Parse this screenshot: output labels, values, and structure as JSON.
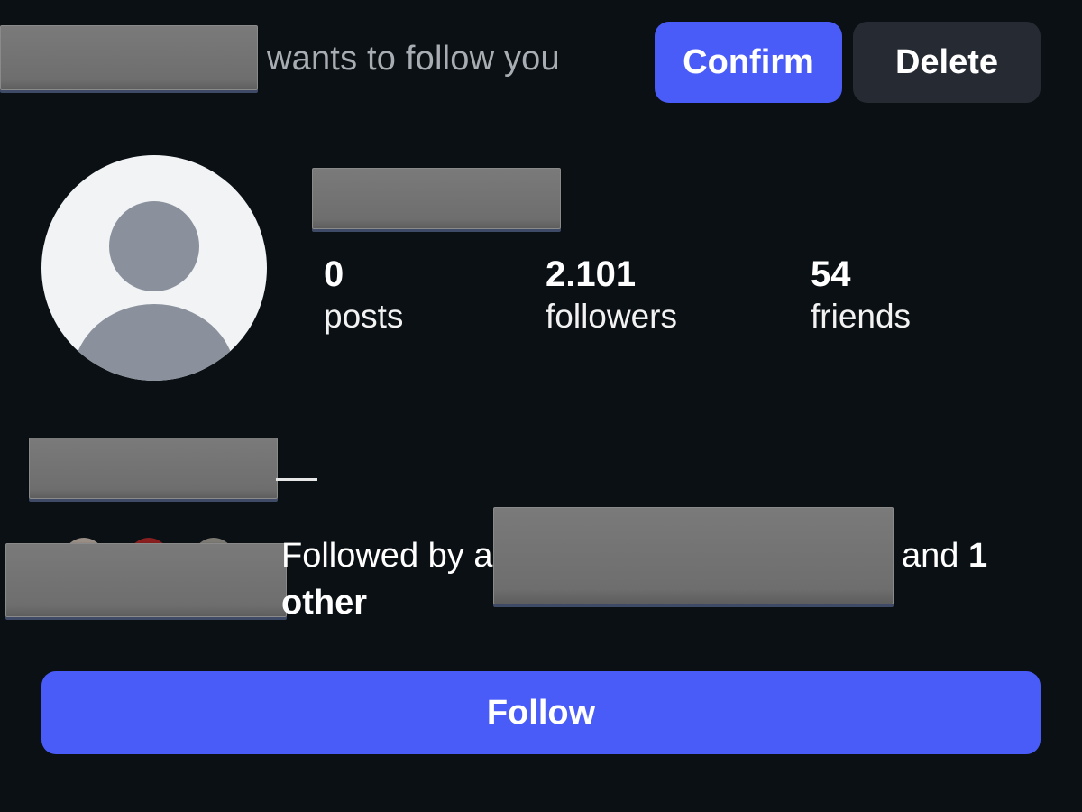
{
  "request": {
    "text": "wants to follow you",
    "confirm_label": "Confirm",
    "delete_label": "Delete"
  },
  "profile": {
    "stats": [
      {
        "value": "0",
        "label": "posts"
      },
      {
        "value": "2.101",
        "label": "followers"
      },
      {
        "value": "54",
        "label": "friends"
      }
    ]
  },
  "mutual": {
    "prefix": "Followed by a",
    "suffix_and": "and ",
    "suffix_count": "1",
    "suffix_other": "other"
  },
  "follow_label": "Follow",
  "colors": {
    "accent": "#4a5cf7",
    "background": "#0b1014",
    "secondary_button": "#262b33"
  }
}
